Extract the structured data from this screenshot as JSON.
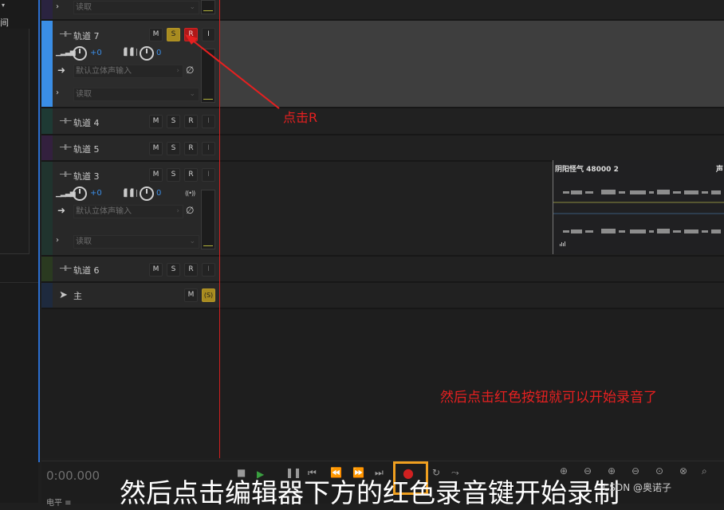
{
  "left_panel": {
    "title": "间",
    "caret": "▾"
  },
  "tracks": [
    {
      "id": "top",
      "dropdown": "读取"
    },
    {
      "id": "t7",
      "name": "轨道 7",
      "m": "M",
      "s": "S",
      "r": "R",
      "i": "I",
      "vol": "+0",
      "pan": "0",
      "input": "默认立体声输入",
      "mode": "读取"
    },
    {
      "id": "t4",
      "name": "轨道 4",
      "m": "M",
      "s": "S",
      "r": "R",
      "i": "I"
    },
    {
      "id": "t5",
      "name": "轨道 5",
      "m": "M",
      "s": "S",
      "r": "R",
      "i": "I"
    },
    {
      "id": "t3",
      "name": "轨道 3",
      "m": "M",
      "s": "S",
      "r": "R",
      "i": "I",
      "vol": "+0",
      "pan": "0",
      "input": "默认立体声输入",
      "mode": "读取",
      "monitor": "((•))"
    },
    {
      "id": "t6",
      "name": "轨道 6",
      "m": "M",
      "s": "S",
      "r": "R",
      "i": "I"
    },
    {
      "id": "master",
      "name": "主",
      "m": "M",
      "s": "(S)"
    }
  ],
  "clip": {
    "title": "阴阳怪气 48000 2",
    "title2": "声"
  },
  "transport": {
    "timecode": "0:00.000",
    "level_label": "电平 ≡"
  },
  "annotations": {
    "click_r": "点击R",
    "then": "然后点击红色按钮就可以开始录音了"
  },
  "caption": "然后点击编辑器下方的红色录音键开始录制",
  "watermark": "CSDN @奥诺子",
  "colors": {
    "playhead": "#d02020",
    "solo": "#a88b20",
    "record": "#b01818",
    "accent_blue": "#3b8ee8",
    "annotation": "#e62020",
    "highlight": "#f0a020"
  }
}
